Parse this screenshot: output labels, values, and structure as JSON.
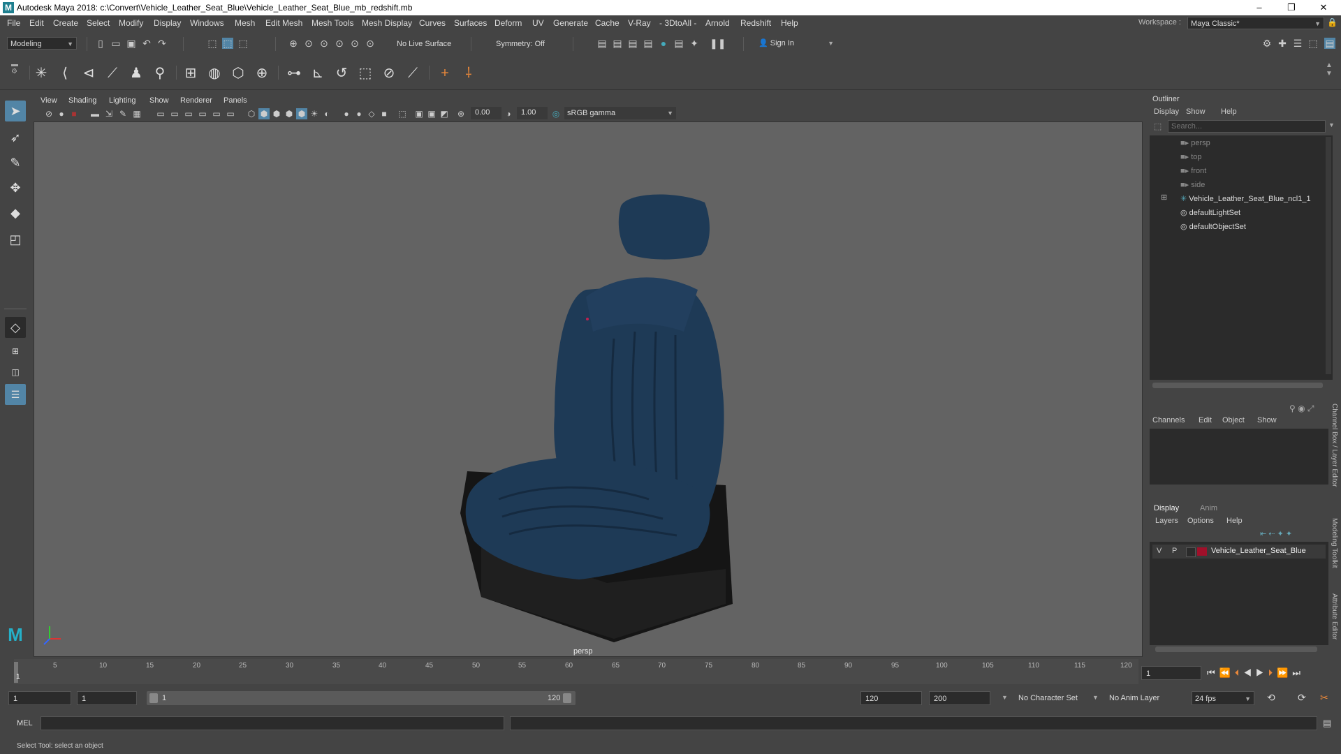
{
  "window": {
    "title": "Autodesk Maya 2018: c:\\Convert\\Vehicle_Leather_Seat_Blue\\Vehicle_Leather_Seat_Blue_mb_redshift.mb",
    "logo": "M",
    "minimize": "–",
    "maximize": "❐",
    "close": "✕"
  },
  "menubar": {
    "items": [
      "File",
      "Edit",
      "Create",
      "Select",
      "Modify",
      "Display",
      "Windows",
      "Mesh",
      "Edit Mesh",
      "Mesh Tools",
      "Mesh Display",
      "Curves",
      "Surfaces",
      "Deform",
      "UV",
      "Generate",
      "Cache",
      "V-Ray",
      "- 3DtoAll -",
      "Arnold",
      "Redshift",
      "Help"
    ],
    "workspace_label": "Workspace :",
    "workspace_value": "Maya Classic*"
  },
  "statusline": {
    "mode": "Modeling",
    "live_surface": "No Live Surface",
    "symmetry": "Symmetry: Off",
    "sign_in": "Sign In"
  },
  "viewport": {
    "menu": [
      "View",
      "Shading",
      "Lighting",
      "Show",
      "Renderer",
      "Panels"
    ],
    "exposure": "0.00",
    "gamma": "1.00",
    "color_space": "sRGB gamma",
    "camera_label": "persp"
  },
  "outliner": {
    "title": "Outliner",
    "menu": [
      "Display",
      "Show",
      "Help"
    ],
    "search_placeholder": "Search...",
    "items": [
      {
        "label": "persp",
        "dim": true,
        "icon": "camera-icon"
      },
      {
        "label": "top",
        "dim": true,
        "icon": "camera-icon"
      },
      {
        "label": "front",
        "dim": true,
        "icon": "camera-icon"
      },
      {
        "label": "side",
        "dim": true,
        "icon": "camera-icon"
      },
      {
        "label": "Vehicle_Leather_Seat_Blue_ncl1_1",
        "dim": false,
        "icon": "transform-icon"
      },
      {
        "label": "defaultLightSet",
        "dim": false,
        "icon": "set-icon"
      },
      {
        "label": "defaultObjectSet",
        "dim": false,
        "icon": "set-icon"
      }
    ]
  },
  "channelbox": {
    "menu": [
      "Channels",
      "Edit",
      "Object",
      "Show"
    ],
    "side_tab": "Channel Box / Layer Editor"
  },
  "layers": {
    "tabs": [
      "Display",
      "Anim"
    ],
    "menu": [
      "Layers",
      "Options",
      "Help"
    ],
    "layer": {
      "v": "V",
      "p": "P",
      "name": "Vehicle_Leather_Seat_Blue",
      "color": "#a0102a"
    },
    "side_tabs": [
      "Modeling Toolkit",
      "Attribute Editor"
    ]
  },
  "timeline": {
    "ticks": [
      "5",
      "10",
      "15",
      "20",
      "25",
      "30",
      "35",
      "40",
      "45",
      "50",
      "55",
      "60",
      "65",
      "70",
      "75",
      "80",
      "85",
      "90",
      "95",
      "100",
      "105",
      "110",
      "115",
      "120"
    ],
    "current_marker": "1",
    "current_frame": "1"
  },
  "range": {
    "start": "1",
    "playback_start": "1",
    "slider_start": "1",
    "slider_end": "120",
    "playback_end": "120",
    "end": "200",
    "character_set": "No Character Set",
    "anim_layer": "No Anim Layer",
    "fps": "24 fps"
  },
  "cmdline": {
    "label": "MEL"
  },
  "helpline": {
    "text": "Select Tool: select an object"
  },
  "colors": {
    "seat_blue": "#1e3a56",
    "seat_base": "#1a1a1a",
    "viewport_bg": "#636363",
    "panel_bg": "#444444",
    "field_bg": "#2b2b2b"
  }
}
